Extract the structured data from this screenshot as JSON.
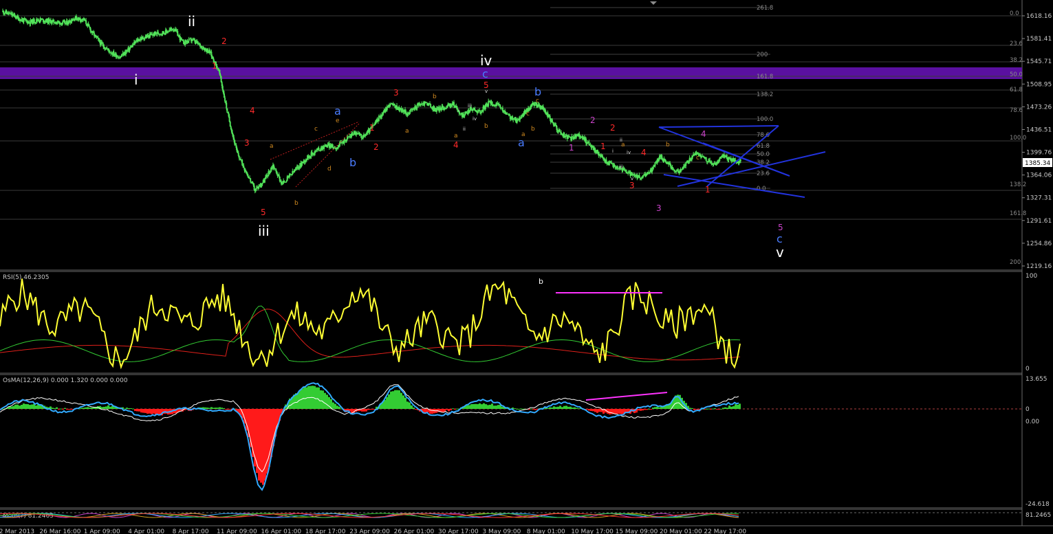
{
  "colors": {
    "bg": "#000000",
    "grid": "#3a3a3a",
    "candle": "#52e35a",
    "rsi": "#ffff33",
    "rsi_ma_red": "#e0201a",
    "rsi_ma_green": "#33cc33",
    "osma_pos": "#33cc33",
    "osma_neg": "#ff1a1a",
    "macd_line": "#33aaff",
    "signal_line": "#ffffff",
    "band": "#5a10a0",
    "channel": "#2233dd",
    "divergence": "#ff33ff",
    "wave_white": "#ffffff",
    "wave_red": "#ff2a2a",
    "wave_orange": "#d08a20",
    "wave_blue": "#4a7cff",
    "wave_magenta": "#cc44cc",
    "last_price_bg": "#ffffff"
  },
  "panels": {
    "rsi": {
      "title": "RSI(5) 46.2305",
      "levels": [
        "100",
        "0"
      ]
    },
    "osma": {
      "title": "OsMA(12,26,9) 0.000 1.320 0.000 0.000",
      "levels": [
        "13.655",
        "0",
        "0.00",
        "-24.618"
      ]
    },
    "bottom": {
      "title": "Mom(?) 81.2465",
      "level": "81.2465"
    }
  },
  "chart_data": {
    "type": "candlestick",
    "price_axis_ticks": [
      "1618.16",
      "1581.41",
      "1545.71",
      "1508.95",
      "1473.26",
      "1436.51",
      "1399.76",
      "1364.06",
      "1327.31",
      "1291.61",
      "1254.86",
      "1219.16"
    ],
    "last_price": "1385.34",
    "time_axis_ticks": [
      "22 Mar 2013",
      "26 Mar 16:00",
      "1 Apr 09:00",
      "4 Apr 01:00",
      "8 Apr 17:00",
      "11 Apr 09:00",
      "16 Apr 01:00",
      "18 Apr 17:00",
      "23 Apr 09:00",
      "26 Apr 01:00",
      "30 Apr 17:00",
      "3 May 09:00",
      "8 May 01:00",
      "10 May 17:00",
      "15 May 09:00",
      "20 May 01:00",
      "22 May 17:00"
    ],
    "close_path": [
      1625,
      1620,
      1612,
      1608,
      1612,
      1610,
      1608,
      1606,
      1615,
      1612,
      1590,
      1572,
      1560,
      1552,
      1565,
      1580,
      1585,
      1590,
      1592,
      1598,
      1575,
      1580,
      1570,
      1560,
      1530,
      1460,
      1400,
      1370,
      1340,
      1355,
      1380,
      1350,
      1365,
      1380,
      1395,
      1405,
      1412,
      1408,
      1420,
      1432,
      1425,
      1440,
      1460,
      1478,
      1470,
      1462,
      1475,
      1480,
      1468,
      1472,
      1478,
      1458,
      1470,
      1465,
      1480,
      1475,
      1460,
      1450,
      1465,
      1478,
      1470,
      1448,
      1430,
      1422,
      1428,
      1415,
      1400,
      1385,
      1378,
      1372,
      1362,
      1360,
      1372,
      1395,
      1380,
      1368,
      1385,
      1400,
      1390,
      1380,
      1395,
      1388,
      1385
    ],
    "fib_right": [
      "0.0",
      "23.6",
      "38.2",
      "50.0",
      "61.8",
      "78.6",
      "100.0",
      "138.2",
      "161.8",
      "200"
    ],
    "fib_mid": [
      "261.8",
      "200",
      "161.8",
      "138.2",
      "100.0",
      "78.6",
      "61.8",
      "50.0",
      "38.2",
      "23.6",
      "0.0"
    ],
    "wave_labels": {
      "white": [
        "ii",
        "i",
        "iii",
        "iv",
        "v"
      ],
      "red": [
        "2",
        "1",
        "4",
        "3",
        "5",
        "1",
        "2",
        "3",
        "4",
        "5",
        "2",
        "1",
        "4",
        "3",
        "1"
      ],
      "orange": [
        "a",
        "b",
        "c",
        "d",
        "e",
        "a",
        "b",
        "a",
        "b",
        "c",
        "a",
        "b",
        "c",
        "a",
        "b",
        "c"
      ],
      "blue": [
        "a",
        "b",
        "c",
        "a",
        "b",
        "c"
      ],
      "magenta": [
        "1",
        "2",
        "3",
        "4",
        "5"
      ],
      "small_white": [
        "i",
        "ii",
        "iii",
        "iv",
        "v",
        "ii",
        "iii",
        "iv",
        "v",
        "i"
      ],
      "rsi_b": "b"
    }
  }
}
